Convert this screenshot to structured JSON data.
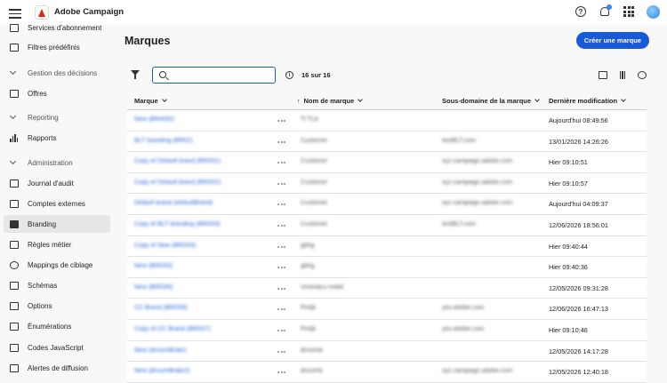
{
  "app": {
    "title": "Adobe Campaign"
  },
  "sidebar": {
    "items": [
      {
        "label": "Services d'abonnement",
        "icon": "envelope-icon"
      },
      {
        "label": "Filtres prédéfinis",
        "icon": "filter-list-icon"
      },
      {
        "section": "Gestion des décisions"
      },
      {
        "label": "Offres",
        "icon": "offers-icon"
      },
      {
        "section": "Reporting"
      },
      {
        "label": "Rapports",
        "icon": "chart-icon"
      },
      {
        "section": "Administration"
      },
      {
        "label": "Journal d'audit",
        "icon": "audit-icon"
      },
      {
        "label": "Comptes externes",
        "icon": "login-icon"
      },
      {
        "label": "Branding",
        "icon": "branding-icon",
        "active": true
      },
      {
        "label": "Règles métier",
        "icon": "rules-icon"
      },
      {
        "label": "Mappings de ciblage",
        "icon": "mapping-icon"
      },
      {
        "label": "Schémas",
        "icon": "schema-icon"
      },
      {
        "label": "Options",
        "icon": "options-icon"
      },
      {
        "label": "Énumérations",
        "icon": "enum-icon"
      },
      {
        "label": "Codes JavaScript",
        "icon": "code-icon"
      },
      {
        "label": "Alertes de diffusion",
        "icon": "alert-mail-icon"
      }
    ]
  },
  "main": {
    "title": "Marques",
    "create_label": "Créer une marque",
    "search": {
      "placeholder": "",
      "value": ""
    },
    "count": "16 sur 16"
  },
  "table": {
    "columns": [
      "Marque",
      "Nom de marque",
      "Sous-domaine de la marque",
      "Dernière modification"
    ],
    "rows": [
      {
        "brand": "New (BRAND)",
        "name": "Tl TLb",
        "subdomain": "",
        "modified": "Aujourd'hui  08:49:56"
      },
      {
        "brand": "BLT branding (BR02)",
        "name": "Customer",
        "subdomain": "testBLT.com",
        "modified": "13/01/2026 14:26:26"
      },
      {
        "brand": "Copy of Default brand (BRD01)",
        "name": "Customer",
        "subdomain": "xyz.campaign.adobe.com",
        "modified": "Hier 09:10:51"
      },
      {
        "brand": "Copy of Default brand (BRD02)",
        "name": "Customer",
        "subdomain": "xyz.campaign.adobe.com",
        "modified": "Hier 09:10:57"
      },
      {
        "brand": "Default brand (defaultBrand)",
        "name": "Customer",
        "subdomain": "xyz.campaign.adobe.com",
        "modified": "Aujourd'hui  04:09:37"
      },
      {
        "brand": "Copy of BLT branding (BRD03)",
        "name": "Customer",
        "subdomain": "testBLT.com",
        "modified": "12/06/2026 18:56:01"
      },
      {
        "brand": "Copy of New (BRD04)",
        "name": "gbhg",
        "subdomain": "",
        "modified": "Hier 09:40:44"
      },
      {
        "brand": "New (BRD05)",
        "name": "gbhg",
        "subdomain": "",
        "modified": "Hier 09:40:36"
      },
      {
        "brand": "New (BRD06)",
        "name": "Vmesdcu mrbkl",
        "subdomain": "",
        "modified": "12/05/2026 09:31:28"
      },
      {
        "brand": "CC Brand (BRD08)",
        "name": "Pmljk",
        "subdomain": "yes.adobe.com",
        "modified": "12/06/2026 16:47:13"
      },
      {
        "brand": "Copy of CC Brand (BRD07)",
        "name": "Pmljk",
        "subdomain": "yes.adobe.com",
        "modified": "Hier 09:10:46"
      },
      {
        "brand": "New (dnuxmBrabr)",
        "name": "dnuxmb",
        "subdomain": "",
        "modified": "12/05/2026 14:17:28"
      },
      {
        "brand": "New (dnuxmBrabr2)",
        "name": "dnuxmb",
        "subdomain": "xyz.campaign.adobe.com",
        "modified": "12/05/2026 12:40:18"
      }
    ]
  },
  "colors": {
    "accent": "#1859d6",
    "link": "#2463d6",
    "brand_red": "#e1251b"
  }
}
